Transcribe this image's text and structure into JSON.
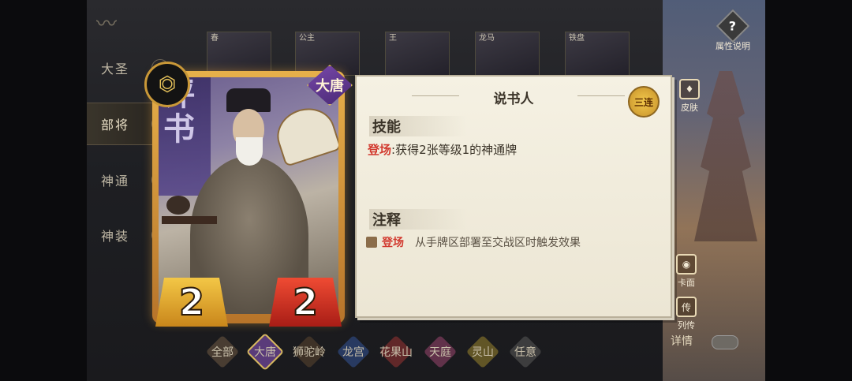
{
  "sidenav": {
    "items": [
      {
        "label": "大圣",
        "active": false,
        "icon": "monkey-icon"
      },
      {
        "label": "部将",
        "active": true,
        "icon": "general-icon"
      },
      {
        "label": "神通",
        "active": false,
        "icon": "spell-icon"
      },
      {
        "label": "神装",
        "active": false,
        "icon": "gear-icon"
      }
    ]
  },
  "thumbs": [
    {
      "label": "春"
    },
    {
      "label": "公主"
    },
    {
      "label": "王"
    },
    {
      "label": "龙马"
    },
    {
      "label": "铁盘"
    }
  ],
  "card": {
    "faction": "大唐",
    "attack": "2",
    "health": "2",
    "banner_text": "评书"
  },
  "panel": {
    "title": "说书人",
    "badge": "三连",
    "skill_heading": "技能",
    "skill_keyword": "登场",
    "skill_text": ":获得2张等级1的神通牌",
    "note_heading": "注释",
    "note_keyword": "登场",
    "note_text": "从手牌区部署至交战区时触发效果"
  },
  "filters": [
    {
      "label": "全部",
      "color": "#5a4a3a",
      "active": false
    },
    {
      "label": "大唐",
      "color": "#5a3b7a",
      "active": true
    },
    {
      "label": "狮驼岭",
      "color": "#4b3b2b",
      "active": false
    },
    {
      "label": "龙宫",
      "color": "#2d4678",
      "active": false
    },
    {
      "label": "花果山",
      "color": "#7a2d2d",
      "active": false
    },
    {
      "label": "天庭",
      "color": "#7a3b5a",
      "active": false
    },
    {
      "label": "灵山",
      "color": "#7a6a2a",
      "active": false
    },
    {
      "label": "任意",
      "color": "#4a4a4a",
      "active": false
    }
  ],
  "right_menu": {
    "help": "属性说明",
    "skin": "皮肤",
    "face": "卡面",
    "bio": "列传",
    "details": "详情"
  },
  "colors": {
    "accent_gold": "#d7b860",
    "keyword_red": "#d23a2f"
  }
}
